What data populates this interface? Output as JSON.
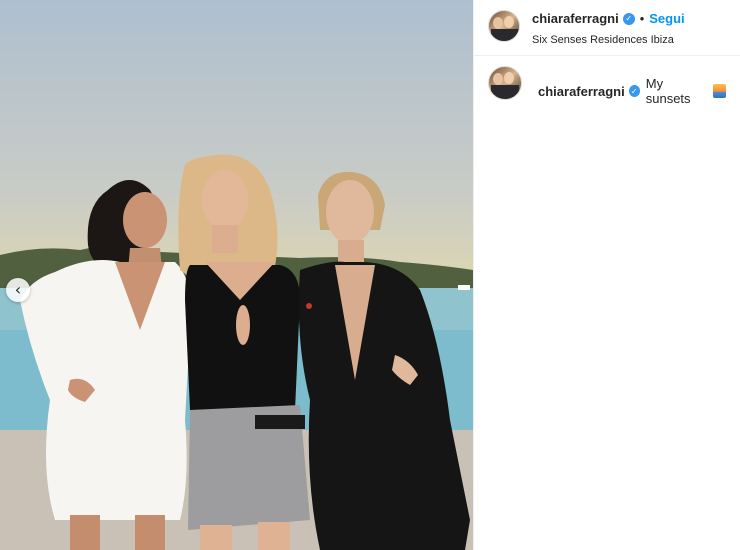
{
  "post": {
    "username": "chiaraferragni",
    "follow_label": "Segui",
    "separator": "•",
    "location": "Six Senses Residences Ibiza",
    "caption": {
      "username": "chiaraferragni",
      "text": "My sunsets",
      "emoji_icon": "sunset-emoji-icon"
    },
    "verified_icon": "verified-badge-icon",
    "carousel_prev_icon": "chevron-left-icon",
    "colors": {
      "link_blue": "#0095f6",
      "verified_blue": "#3897f0",
      "text": "#262626",
      "divider": "#efefef"
    }
  }
}
